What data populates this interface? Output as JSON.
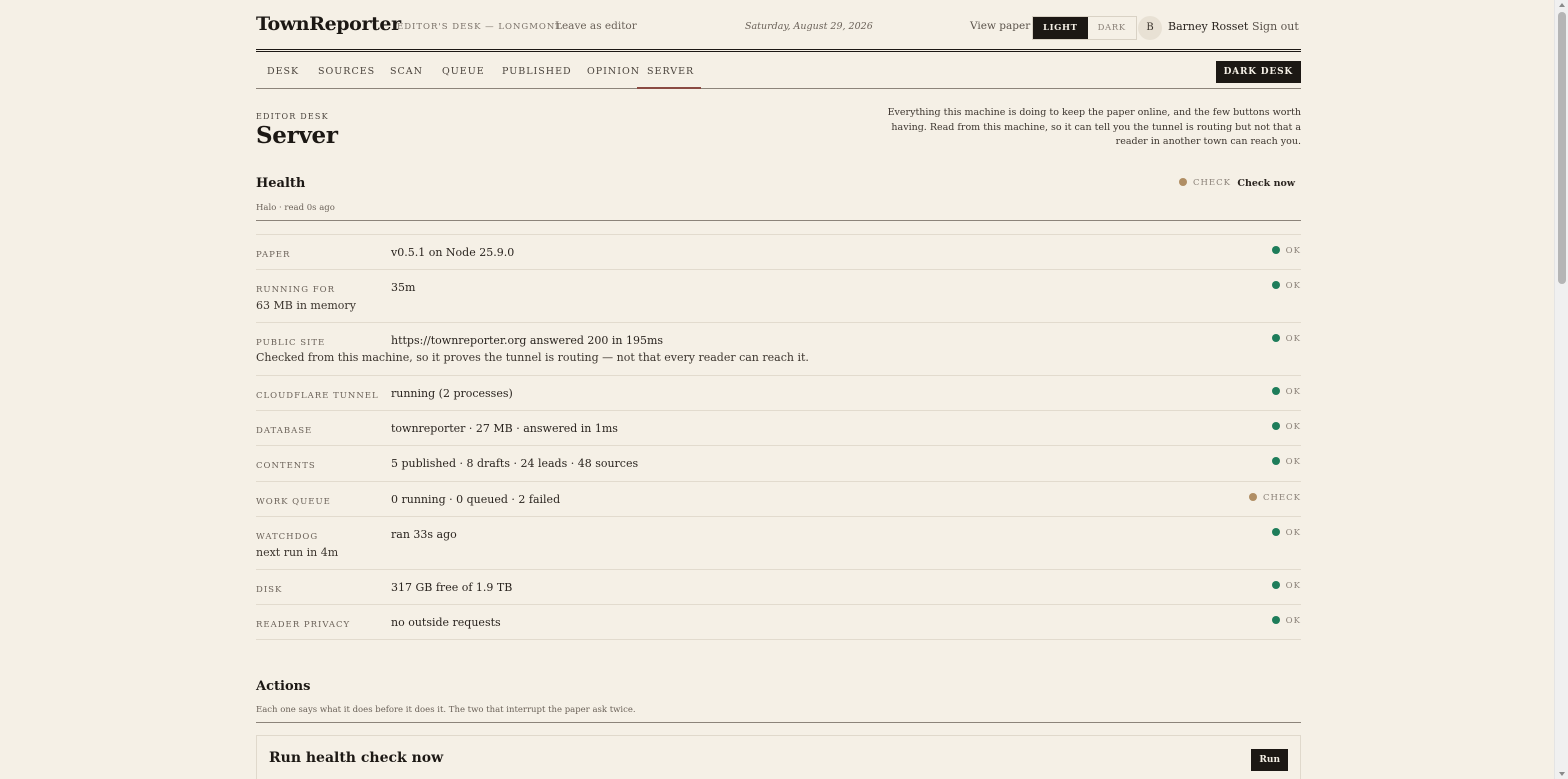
{
  "masthead": {
    "logo": "TownReporter",
    "desk_line": "EDITOR'S DESK — LONGMONT",
    "leave_link": "Leave as editor",
    "date": "Saturday, August 29, 2026",
    "view_paper": "View paper",
    "theme_light": "LIGHT",
    "theme_dark": "DARK",
    "avatar_initial": "B",
    "user_name": "Barney Rosset",
    "sign_out": "Sign out"
  },
  "nav": {
    "tabs": [
      "DESK",
      "SOURCES",
      "SCAN",
      "QUEUE",
      "PUBLISHED",
      "OPINION",
      "SERVER"
    ],
    "active": "SERVER",
    "dark_desk": "DARK DESK"
  },
  "header": {
    "eyebrow": "EDITOR DESK",
    "title": "Server",
    "intro_lines": [
      "Everything this machine is doing to keep the paper online, and the few buttons worth",
      "having. Read from this machine, so it can tell you the tunnel is routing but not that a",
      "reader in another town can reach you."
    ]
  },
  "health": {
    "title": "Health",
    "subtitle": "Halo · read 0s ago",
    "status": "CHECK",
    "check_now": "Check now",
    "rows": [
      {
        "label": "PAPER",
        "value": "v0.5.1 on Node 25.9.0",
        "sub": "",
        "status": "OK"
      },
      {
        "label": "RUNNING FOR",
        "value": "35m",
        "sub": "63 MB in memory",
        "status": "OK"
      },
      {
        "label": "PUBLIC SITE",
        "value": "https://townreporter.org answered 200 in 195ms",
        "sub": "Checked from this machine, so it proves the tunnel is routing — not that every reader can reach it.",
        "status": "OK"
      },
      {
        "label": "CLOUDFLARE TUNNEL",
        "value": "running (2 processes)",
        "sub": "",
        "status": "OK"
      },
      {
        "label": "DATABASE",
        "value": "townreporter · 27 MB · answered in 1ms",
        "sub": "",
        "status": "OK"
      },
      {
        "label": "CONTENTS",
        "value": "5 published · 8 drafts · 24 leads · 48 sources",
        "sub": "",
        "status": "OK"
      },
      {
        "label": "WORK QUEUE",
        "value": "0 running · 0 queued · 2 failed",
        "sub": "",
        "status": "CHECK"
      },
      {
        "label": "WATCHDOG",
        "value": "ran 33s ago",
        "sub": "next run in 4m",
        "status": "OK"
      },
      {
        "label": "DISK",
        "value": "317 GB free of 1.9 TB",
        "sub": "",
        "status": "OK"
      },
      {
        "label": "READER PRIVACY",
        "value": "no outside requests",
        "sub": "",
        "status": "OK"
      }
    ]
  },
  "actions": {
    "title": "Actions",
    "subtitle": "Each one says what it does before it does it. The two that interrupt the paper ask twice.",
    "cards": [
      {
        "title": "Run health check now",
        "button": "Run"
      }
    ]
  },
  "colors": {
    "background": "#f5f0e6",
    "ink": "#1c1814",
    "ok": "#1e7d5a",
    "check": "#b08e64",
    "active_tab": "#8a4a42"
  }
}
